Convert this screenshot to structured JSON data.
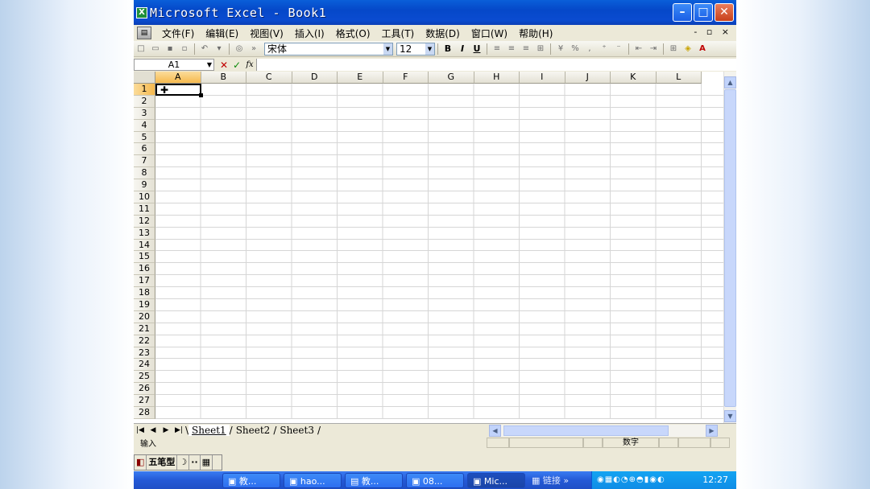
{
  "window": {
    "title": "Microsoft Excel - Book1",
    "app_icon_glyph": "X",
    "controls": {
      "minimize": "–",
      "maximize": "□",
      "close": "✕"
    }
  },
  "menu": {
    "items": [
      "文件(F)",
      "编辑(E)",
      "视图(V)",
      "插入(I)",
      "格式(O)",
      "工具(T)",
      "数据(D)",
      "窗口(W)",
      "帮助(H)"
    ],
    "doc_controls": "- ▫ ×"
  },
  "toolbar": {
    "font_name": "宋体",
    "font_size": "12",
    "bold": "B",
    "italic": "I",
    "underline": "U",
    "percent": "%"
  },
  "formula_bar": {
    "name_box": "A1",
    "cancel": "✕",
    "enter": "✓",
    "function": "fx"
  },
  "grid": {
    "columns": [
      "A",
      "B",
      "C",
      "D",
      "E",
      "F",
      "G",
      "H",
      "I",
      "J",
      "K",
      "L"
    ],
    "rows": [
      "1",
      "2",
      "3",
      "4",
      "5",
      "6",
      "7",
      "8",
      "9",
      "10",
      "11",
      "12",
      "13",
      "14",
      "15",
      "16",
      "17",
      "18",
      "19",
      "20",
      "21",
      "22",
      "23",
      "24",
      "25",
      "26",
      "27",
      "28"
    ],
    "active_column": "A",
    "active_row": "1"
  },
  "sheets": {
    "tabs": [
      "Sheet1",
      "Sheet2",
      "Sheet3"
    ],
    "active": "Sheet1"
  },
  "status": {
    "mode": "输入",
    "num_indicator": "数字"
  },
  "ime": {
    "segments": [
      "五笔型",
      "☽",
      "··",
      "▦"
    ]
  },
  "taskbar": {
    "buttons": [
      "教...",
      "hao...",
      "教...",
      "08...",
      "Mic...",
      "链接"
    ],
    "chevron": "»",
    "clock": "12:27"
  },
  "colors": {
    "title_blue": "#0548c9",
    "selected_header": "#f6b94d",
    "taskbar_blue": "#2459d6"
  }
}
